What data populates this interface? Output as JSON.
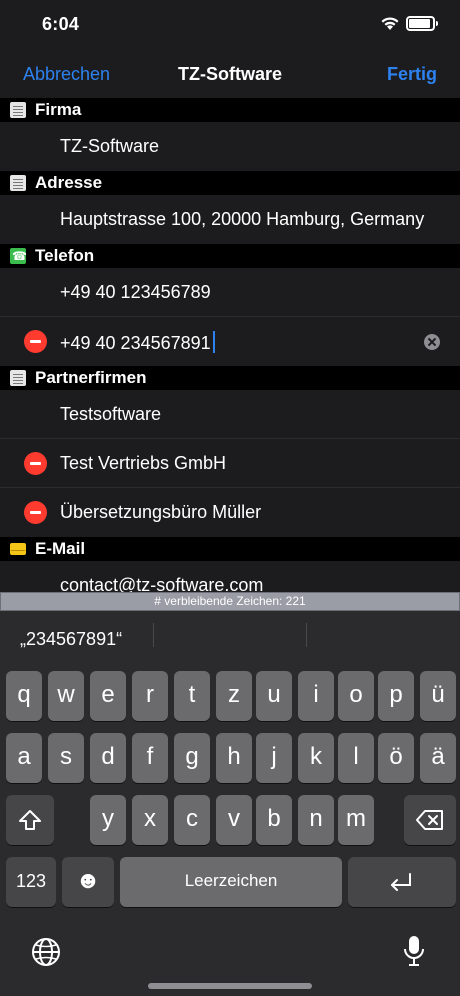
{
  "status": {
    "time": "6:04"
  },
  "nav": {
    "cancel": "Abbrechen",
    "title": "TZ-Software",
    "done": "Fertig"
  },
  "sections": [
    {
      "title": "Firma",
      "icon": "document-icon",
      "rows": [
        "TZ-Software"
      ]
    },
    {
      "title": "Adresse",
      "icon": "document-icon",
      "rows": [
        "Hauptstrasse 100, 20000 Hamburg, Germany"
      ]
    },
    {
      "title": "Telefon",
      "icon": "phone-icon",
      "rows": [
        "+49 40 123456789",
        "+49 40 234567891"
      ]
    },
    {
      "title": "Partnerfirmen",
      "icon": "document-icon",
      "rows": [
        "Testsoftware",
        "Test Vertriebs GmbH",
        "Übersetzungsbüro Müller"
      ]
    },
    {
      "title": "E-Mail",
      "icon": "mail-icon",
      "rows": [
        "contact@tz-software.com"
      ]
    }
  ],
  "remaining": "# verbleibende Zeichen: 221",
  "keyboard": {
    "prediction": "„234567891“",
    "row1": [
      "q",
      "w",
      "e",
      "r",
      "t",
      "z",
      "u",
      "i",
      "o",
      "p",
      "ü"
    ],
    "row2": [
      "a",
      "s",
      "d",
      "f",
      "g",
      "h",
      "j",
      "k",
      "l",
      "ö",
      "ä"
    ],
    "row3": [
      "y",
      "x",
      "c",
      "v",
      "b",
      "n",
      "m"
    ],
    "numbers": "123",
    "emoji": "☻",
    "space": "Leerzeichen"
  }
}
